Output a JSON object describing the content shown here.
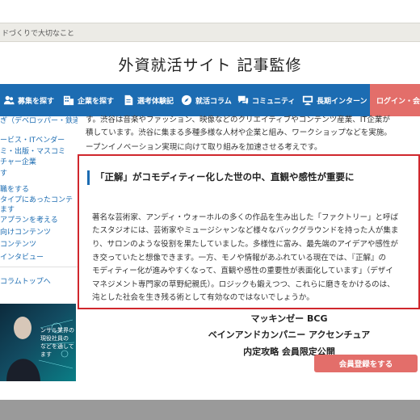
{
  "topstrip": {
    "text": "ドづくりで大切なこと"
  },
  "site_title": "外資就活サイト 記事監修",
  "nav": {
    "items": [
      {
        "label": "募集を探す",
        "icon": "users-icon"
      },
      {
        "label": "企業を探す",
        "icon": "building-icon"
      },
      {
        "label": "選考体験記",
        "icon": "document-icon"
      },
      {
        "label": "就活コラム",
        "icon": "compass-icon"
      },
      {
        "label": "コミュニティ",
        "icon": "chat-icon"
      },
      {
        "label": "長期インターン",
        "icon": "monitor-icon"
      }
    ],
    "login_label": "ログイン・会員"
  },
  "sidebar": {
    "items": [
      "ぎ（デベロッパー・鉄道",
      "ービス・ITベンダー",
      "ミ・出版・マスコミ",
      "チャー企業",
      "す",
      "職をする",
      "タイプにあったコンテ",
      "ます",
      "アプランを考える",
      "向けコンテンツ",
      "コンテンツ",
      "インタビュー"
    ],
    "column_top": "コラムトップへ",
    "banner_lines": [
      "ンサル業界の",
      "現役社員の",
      "などを通して",
      "ます"
    ]
  },
  "main": {
    "intro_lines": [
      "す。渋谷は音楽やファッション、映像などのクリエイティブやコンテンツ産業、IT企業が",
      "積しています。渋谷に集まる多種多様な人材や企業と組み、ワークショップなどを実施。",
      "ープンイノベーション実現に向けて取り組みを加速させる考えです。"
    ],
    "box_heading": "「正解」がコモディティー化した世の中、直観や感性が重要に",
    "box_lines": [
      "著名な芸術家、アンディ・ウォーホルの多くの作品を生み出した「ファクトリー」と呼ば",
      "たスタジオには、芸術家やミュージシャンなど様々なバックグラウンドを持った人が集ま",
      "り、サロンのような役割を果たしていました。多様性に富み、最先端のアイデアや感性が",
      "き交っていたと想像できます。一方、モノや情報があふれている現在では、『正解』の",
      "モディティー化が進みやすくなって、直観や感性の重要性が表面化しています」（デザイ",
      "マネジメント専門家の草野紀親氏）。ロジックも鍛えつつ、これらに磨きをかけるのは、",
      "沌とした社会を生き残る術として有効なのではないでしょうか。"
    ],
    "promo_lines": [
      "マッキンゼー BCG",
      "ベインアンドカンパニー アクセンチュア",
      "内定攻略 会員限定公開"
    ],
    "register_label": "会員登録をする"
  },
  "colors": {
    "nav_blue": "#1c6cb2",
    "accent_red": "#e36e6a",
    "box_border": "#d0272d"
  }
}
